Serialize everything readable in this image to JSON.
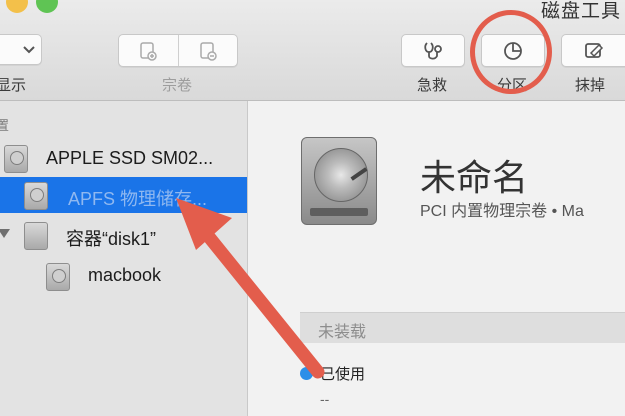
{
  "toolbar": {
    "app_title": "磁盘工具",
    "buttons": {
      "view": "显示",
      "volume": "宗卷",
      "rescue": "急救",
      "partition": "分区",
      "erase": "抹掉"
    }
  },
  "sidebar": {
    "section_label": "置",
    "items": [
      {
        "label": "APPLE SSD SM02...",
        "selected": false
      },
      {
        "label": "APFS 物理储存...",
        "selected": true
      },
      {
        "label": "容器“disk1”",
        "selected": false
      },
      {
        "label": "macbook",
        "selected": false
      }
    ]
  },
  "detail": {
    "volume_name": "未命名",
    "volume_description": "PCI 内置物理宗卷 • Ma",
    "status_bar": "未装载",
    "usage": {
      "label": "已使用",
      "value": "--",
      "color": "#2c8fe8"
    }
  },
  "annotation": {
    "circle_color": "#e35d4c",
    "arrow_color": "#e35d4c"
  },
  "colors": {
    "selection": "#1a74e8",
    "toolbar_bg": "#e2e2e2"
  }
}
